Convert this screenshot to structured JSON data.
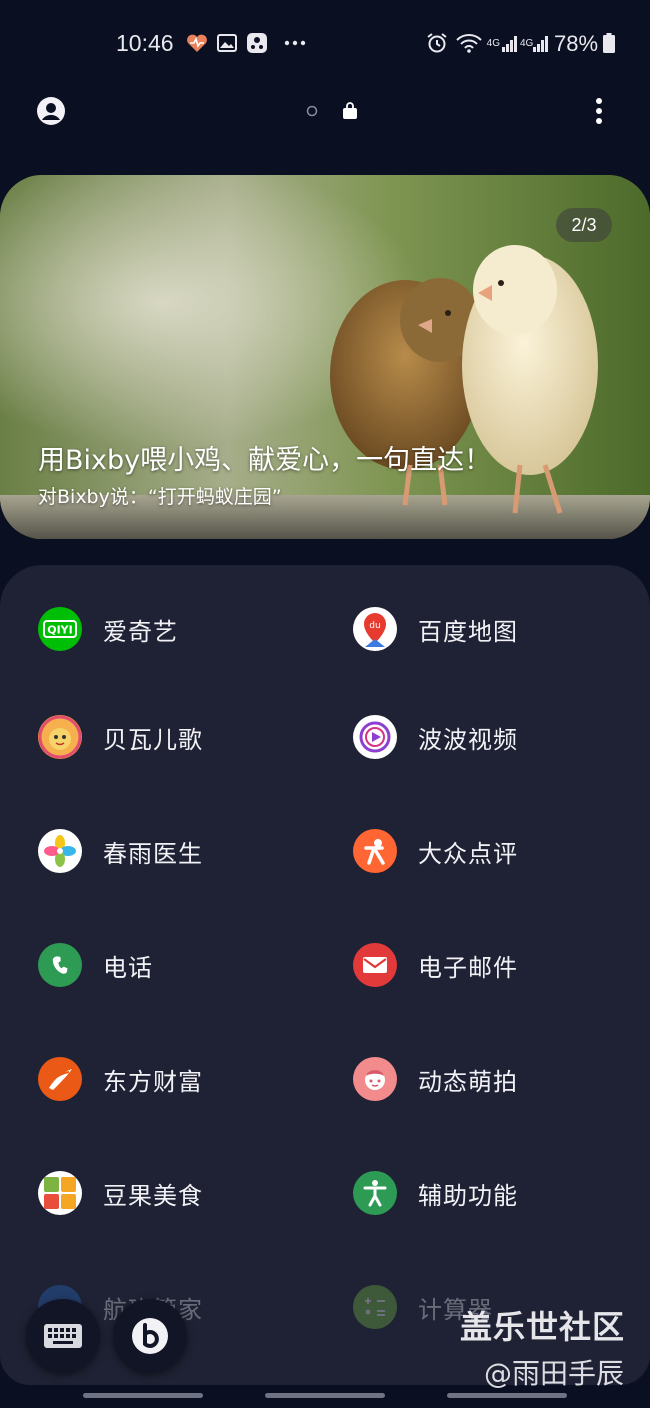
{
  "status_bar": {
    "time": "10:46",
    "battery": "78%",
    "network_label": "4G",
    "left_icons": [
      "health-icon",
      "gallery-icon",
      "game-launcher-icon",
      "more-notifications-icon"
    ],
    "right_icons": [
      "alarm-icon",
      "wifi-icon",
      "signal-icon",
      "battery-icon"
    ]
  },
  "header": {
    "profile_icon": "profile-icon",
    "page_indicator": [
      "dot-inactive",
      "bag-active"
    ],
    "menu_icon": "more-vertical-icon"
  },
  "banner": {
    "counter": "2/3",
    "title": "用Bixby喂小鸡、献爱心，一句直达！",
    "subtitle": "对Bixby说：“打开蚂蚁庄园”"
  },
  "apps": [
    {
      "label": "爱奇艺",
      "icon": "iqiyi-icon",
      "color": "#00be06"
    },
    {
      "label": "百度地图",
      "icon": "baidu-map-icon",
      "color": "#ffffff"
    },
    {
      "label": "贝瓦儿歌",
      "icon": "beva-icon",
      "color": "#f29b3a"
    },
    {
      "label": "波波视频",
      "icon": "bobo-video-icon",
      "color": "#ffffff"
    },
    {
      "label": "春雨医生",
      "icon": "chunyu-icon",
      "color": "#ffffff"
    },
    {
      "label": "大众点评",
      "icon": "dianping-icon",
      "color": "#ff6633"
    },
    {
      "label": "电话",
      "icon": "phone-icon",
      "color": "#2e9b54"
    },
    {
      "label": "电子邮件",
      "icon": "email-icon",
      "color": "#e23a3a"
    },
    {
      "label": "东方财富",
      "icon": "eastmoney-icon",
      "color": "#ea5a16"
    },
    {
      "label": "动态萌拍",
      "icon": "dongtai-mengpai-icon",
      "color": "#f28b8b"
    },
    {
      "label": "豆果美食",
      "icon": "douguo-icon",
      "color": "#ffffff"
    },
    {
      "label": "辅助功能",
      "icon": "accessibility-icon",
      "color": "#2e9b54"
    },
    {
      "label": "航班管家",
      "icon": "flight-icon",
      "color": "#2f6fd1"
    },
    {
      "label": "计算器",
      "icon": "calculator-icon",
      "color": "#7bc044"
    }
  ],
  "bottom": {
    "keyboard_icon": "keyboard-icon",
    "bixby_icon": "bixby-icon"
  },
  "watermark": {
    "line1": "盖乐世社区",
    "line2": "@雨田手辰"
  }
}
